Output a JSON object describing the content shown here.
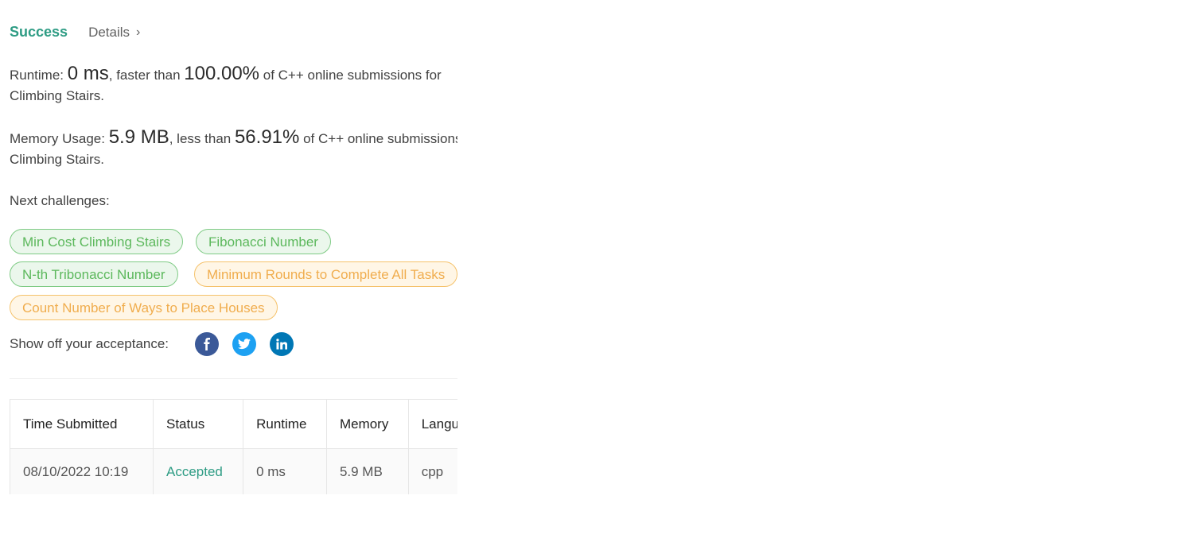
{
  "header": {
    "status": "Success",
    "details_label": "Details"
  },
  "runtime": {
    "prefix": "Runtime: ",
    "value": "0 ms",
    "middle": ", faster than ",
    "percent": "100.00%",
    "suffix": " of C++ online submissions for",
    "problem": "Climbing Stairs."
  },
  "memory": {
    "prefix": "Memory Usage: ",
    "value": "5.9 MB",
    "middle": ", less than ",
    "percent": "56.91%",
    "suffix": " of C++ online submissions for",
    "problem": "Climbing Stairs."
  },
  "next_challenges": {
    "label": "Next challenges:",
    "items": [
      {
        "label": "Min Cost Climbing Stairs",
        "difficulty": "easy"
      },
      {
        "label": "Fibonacci Number",
        "difficulty": "easy"
      },
      {
        "label": "N-th Tribonacci Number",
        "difficulty": "easy"
      },
      {
        "label": "Minimum Rounds to Complete All Tasks",
        "difficulty": "medium"
      },
      {
        "label": "Count Number of Ways to Place Houses",
        "difficulty": "medium"
      }
    ]
  },
  "share": {
    "label": "Show off your acceptance:",
    "icons": [
      "facebook-icon",
      "twitter-icon",
      "linkedin-icon"
    ]
  },
  "submissions": {
    "headers": [
      "Time Submitted",
      "Status",
      "Runtime",
      "Memory",
      "Language"
    ],
    "rows": [
      [
        "08/10/2022 10:19",
        "Accepted",
        "0 ms",
        "5.9 MB",
        "cpp"
      ]
    ]
  },
  "colors": {
    "accent": "#2e9c84",
    "easy": "#5cb85c",
    "medium": "#f0ad4e",
    "facebook": "#3b5998",
    "twitter": "#1da1f2",
    "linkedin": "#0077b5"
  }
}
